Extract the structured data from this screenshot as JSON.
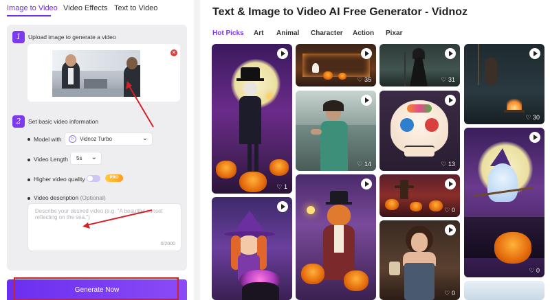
{
  "tabs": [
    {
      "label": "Image to Video",
      "active": true
    },
    {
      "label": "Video Effects",
      "active": false
    },
    {
      "label": "Text to Video",
      "active": false
    }
  ],
  "step1": {
    "num": "1",
    "label": "Upload image to generate a video"
  },
  "step2": {
    "num": "2",
    "label": "Set basic video information"
  },
  "model": {
    "label": "Model with",
    "value": "Vidnoz Turbo"
  },
  "length": {
    "label": "Video Length",
    "value": "5s"
  },
  "quality": {
    "label": "Higher video quality",
    "badge": "PRO",
    "enabled": false
  },
  "description": {
    "label": "Video description",
    "optional": "(Optional)",
    "placeholder": "Describe your desired video (e.g. \"A beautiful sunset reflecting on the sea.\")",
    "value": "",
    "counter": "0/2000"
  },
  "generate_label": "Generate Now",
  "page_title": "Text & Image to Video AI Free Generator - Vidnoz",
  "categories": [
    {
      "label": "Hot Picks",
      "active": true
    },
    {
      "label": "Art",
      "active": false
    },
    {
      "label": "Animal",
      "active": false
    },
    {
      "label": "Character",
      "active": false
    },
    {
      "label": "Action",
      "active": false
    },
    {
      "label": "Pixar",
      "active": false
    }
  ],
  "gallery": {
    "col1": [
      {
        "likes": "♡ 1"
      },
      {
        "likes": ""
      }
    ],
    "col2": [
      {
        "likes": "♡ 35"
      },
      {
        "likes": "♡ 14"
      },
      {
        "likes": ""
      }
    ],
    "col3": [
      {
        "likes": "♡ 31"
      },
      {
        "likes": "♡ 13"
      },
      {
        "likes": "♡ 0"
      },
      {
        "likes": "♡ 0"
      }
    ],
    "col4": [
      {
        "likes": "♡ 30"
      },
      {
        "likes": "♡ 0"
      },
      {
        "likes": ""
      }
    ]
  },
  "colors": {
    "accent": "#7b3af0",
    "annotation": "#d42027",
    "pro": "#ff9b1f"
  },
  "icons": {
    "play": "play-icon",
    "remove": "close-circle-icon",
    "chevron": "chevron-down-icon",
    "model": "vidnoz-logo-icon"
  }
}
